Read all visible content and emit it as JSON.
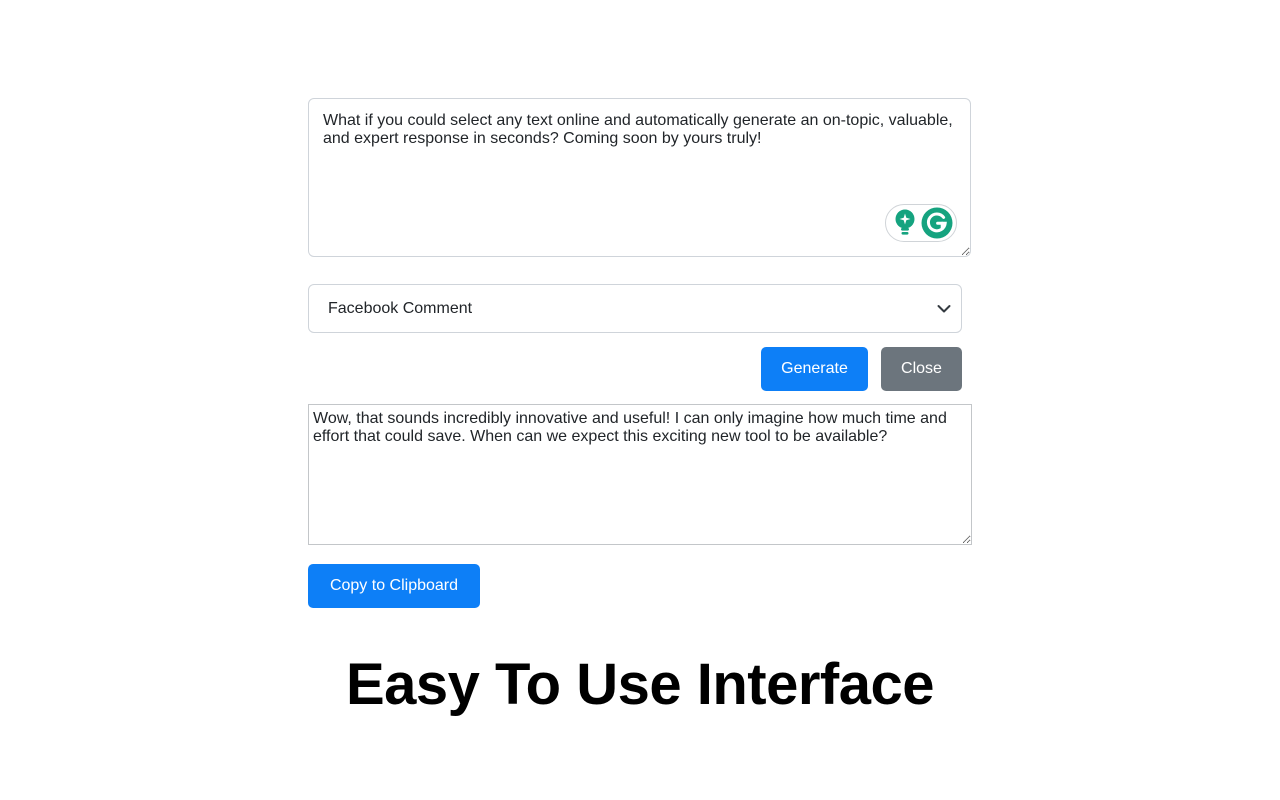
{
  "prompt": {
    "value": "What if you could select any text online and automatically generate an on-topic, valuable, and expert response in seconds? Coming soon by yours truly!"
  },
  "grammarly": {
    "suggest_icon": "lightbulb-sparkle-icon",
    "logo_icon": "grammarly-g-icon",
    "color": "#15a37f"
  },
  "type_select": {
    "selected": "Facebook Comment"
  },
  "actions": {
    "generate_label": "Generate",
    "close_label": "Close",
    "copy_label": "Copy to Clipboard"
  },
  "response": {
    "value": "Wow, that sounds incredibly innovative and useful! I can only imagine how much time and effort that could save. When can we expect this exciting new tool to be available?"
  },
  "headline": "Easy To Use Interface",
  "colors": {
    "primary": "#0d7ff7",
    "secondary": "#6c757d",
    "grammarly": "#15a37f"
  }
}
